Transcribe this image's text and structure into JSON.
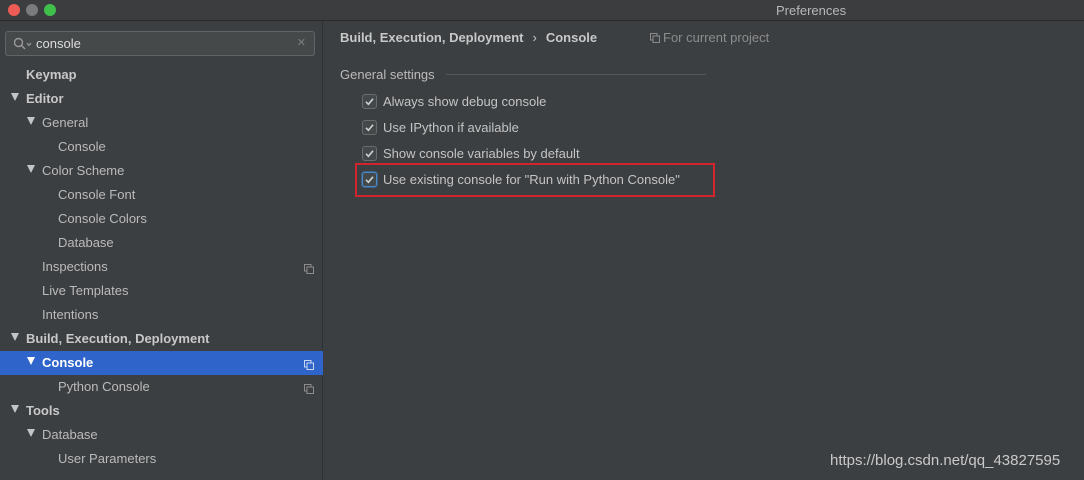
{
  "window": {
    "title": "Preferences"
  },
  "search": {
    "value": "console"
  },
  "tree": [
    {
      "label": "Keymap",
      "bold": true
    },
    {
      "label": "Editor",
      "bold": true
    },
    {
      "label": "General"
    },
    {
      "label": "Console"
    },
    {
      "label": "Color Scheme"
    },
    {
      "label": "Console Font"
    },
    {
      "label": "Console Colors"
    },
    {
      "label": "Database"
    },
    {
      "label": "Inspections"
    },
    {
      "label": "Live Templates"
    },
    {
      "label": "Intentions"
    },
    {
      "label": "Build, Execution, Deployment",
      "bold": true
    },
    {
      "label": "Console",
      "selected": true
    },
    {
      "label": "Python Console"
    },
    {
      "label": "Tools",
      "bold": true
    },
    {
      "label": "Database"
    },
    {
      "label": "User Parameters"
    }
  ],
  "breadcrumb": {
    "parent": "Build, Execution, Deployment",
    "separator": "›",
    "current": "Console",
    "scope": "For current project"
  },
  "settings": {
    "group_title": "General settings",
    "options": [
      {
        "label": "Always show debug console",
        "checked": true
      },
      {
        "label": "Use IPython if available",
        "checked": true
      },
      {
        "label": "Show console variables by default",
        "checked": true
      },
      {
        "label": "Use existing console for \"Run with Python Console\"",
        "checked": true,
        "highlighted": true
      }
    ]
  },
  "watermark": "https://blog.csdn.net/qq_43827595",
  "colors": {
    "selection": "#2f65ca",
    "highlight_border": "#d0252e",
    "background": "#3c3f41"
  }
}
